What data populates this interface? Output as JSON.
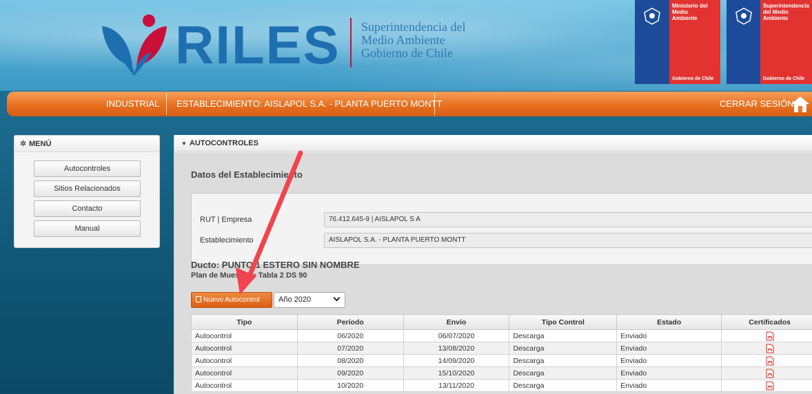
{
  "header": {
    "brand": "RILES",
    "subtitle_lines": [
      "Superintendencia del",
      "Medio Ambiente",
      "Gobierno de Chile"
    ],
    "gov_logos": [
      {
        "lines": [
          "Ministerio del",
          "Medio",
          "Ambiente"
        ],
        "footer": "Gobierno de Chile"
      },
      {
        "lines": [
          "Superintendencia",
          "del Medio",
          "Ambiente"
        ],
        "footer": "Gobierno de Chile"
      }
    ]
  },
  "nav": {
    "industrial": "INDUSTRIAL",
    "establecimiento": "ESTABLECIMIENTO: AISLAPOL S.A. - PLANTA PUERTO MONTT",
    "logout": "CERRAR SESIÓN"
  },
  "menu": {
    "title": "MENÚ",
    "items": [
      "Autocontroles",
      "Sitios Relacionados",
      "Contacto",
      "Manual"
    ]
  },
  "main": {
    "panel_title": "AUTOCONTROLES",
    "section_title": "Datos del Establecimiento",
    "rut_label": "RUT | Empresa",
    "rut_value": "76.412.645-9 | AISLAPOL S A",
    "est_label": "Establecimiento",
    "est_value": "AISLAPOL S.A. - PLANTA PUERTO MONTT",
    "ducto": "Ducto: PUNTO 1 ESTERO SIN NOMBRE",
    "plan": "Plan de Muestreo: Tabla 2 DS 90",
    "new_button": "Nuevo Autocontrol",
    "year_selected": "Año 2020"
  },
  "table": {
    "headers": [
      "Tipo",
      "Período",
      "Envío",
      "Tipo Control",
      "Estado",
      "Certificados"
    ],
    "rows": [
      [
        "Autocontrol",
        "06/2020",
        "06/07/2020",
        "Descarga",
        "Enviado"
      ],
      [
        "Autocontrol",
        "07/2020",
        "13/08/2020",
        "Descarga",
        "Enviado"
      ],
      [
        "Autocontrol",
        "08/2020",
        "14/09/2020",
        "Descarga",
        "Enviado"
      ],
      [
        "Autocontrol",
        "09/2020",
        "15/10/2020",
        "Descarga",
        "Enviado"
      ],
      [
        "Autocontrol",
        "10/2020",
        "13/11/2020",
        "Descarga",
        "Enviado"
      ]
    ]
  },
  "colors": {
    "nav_orange": "#e86f1f",
    "brand_blue": "#1d6fb0",
    "gov_red": "#e23331",
    "gov_blue": "#1d4b9a",
    "arrow_red": "#f0444f",
    "pdf_red": "#d9251d"
  },
  "icons": {
    "menu": "gear-icon",
    "panel": "triangle-down-icon",
    "home": "home-icon",
    "certificate": "pdf-icon",
    "button": "document-icon",
    "annotation": "arrow-icon"
  }
}
